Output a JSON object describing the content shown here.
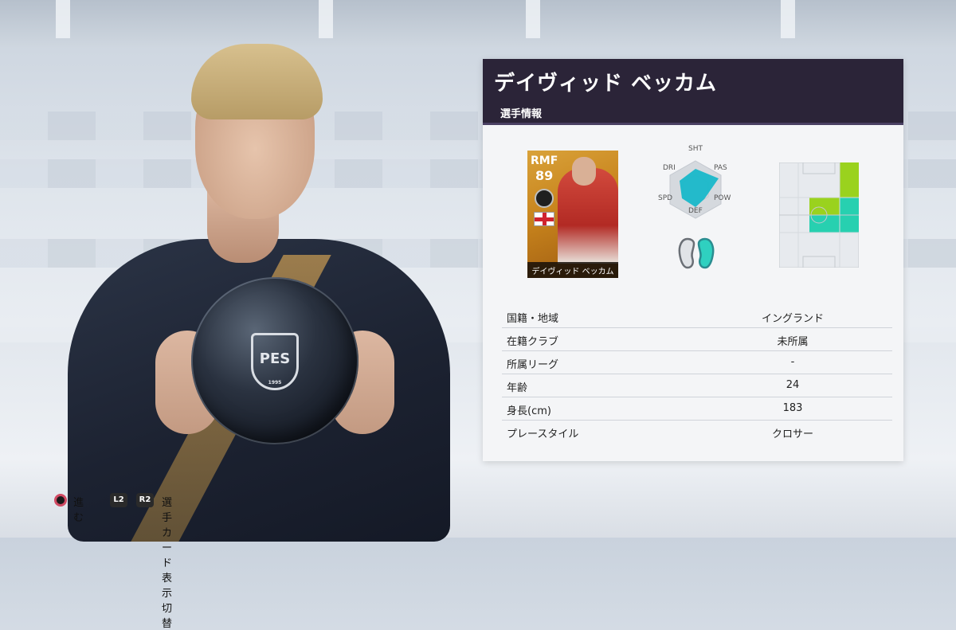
{
  "player": {
    "name": "デイヴィッド ベッカム",
    "section_tab": "選手情報",
    "card": {
      "position": "RMF",
      "rating": "89",
      "name": "デイヴィッド ベッカム"
    },
    "radar_labels": [
      "SHT",
      "PAS",
      "POW",
      "DEF",
      "SPD",
      "DRI"
    ],
    "radar_values": {
      "SHT": 0.55,
      "PAS": 0.95,
      "POW": 0.35,
      "DEF": 0.5,
      "SPD": 0.5,
      "DRI": 0.55
    },
    "foot_icon": "feet-icon",
    "pitch_icon": "pitch-position-icon"
  },
  "info": [
    {
      "label": "国籍・地域",
      "value": "イングランド"
    },
    {
      "label": "在籍クラブ",
      "value": "未所属"
    },
    {
      "label": "所属リーグ",
      "value": "-"
    },
    {
      "label": "年齢",
      "value": "24"
    },
    {
      "label": "身長(cm)",
      "value": "183"
    },
    {
      "label": "プレースタイル",
      "value": "クロサー"
    }
  ],
  "controls": {
    "advance_label": "進む",
    "l2_label": "L2",
    "r2_label": "R2",
    "toggle_label": "選手カード表示切替"
  },
  "ball": {
    "crest_text": "PES",
    "year": "1995"
  },
  "colors": {
    "header_bg": "#2b2438",
    "card_gold": "#d9a23a",
    "radar_fill": "#19b8c9",
    "pitch_primary": "#27d0b0",
    "pitch_secondary": "#9ad21e"
  }
}
